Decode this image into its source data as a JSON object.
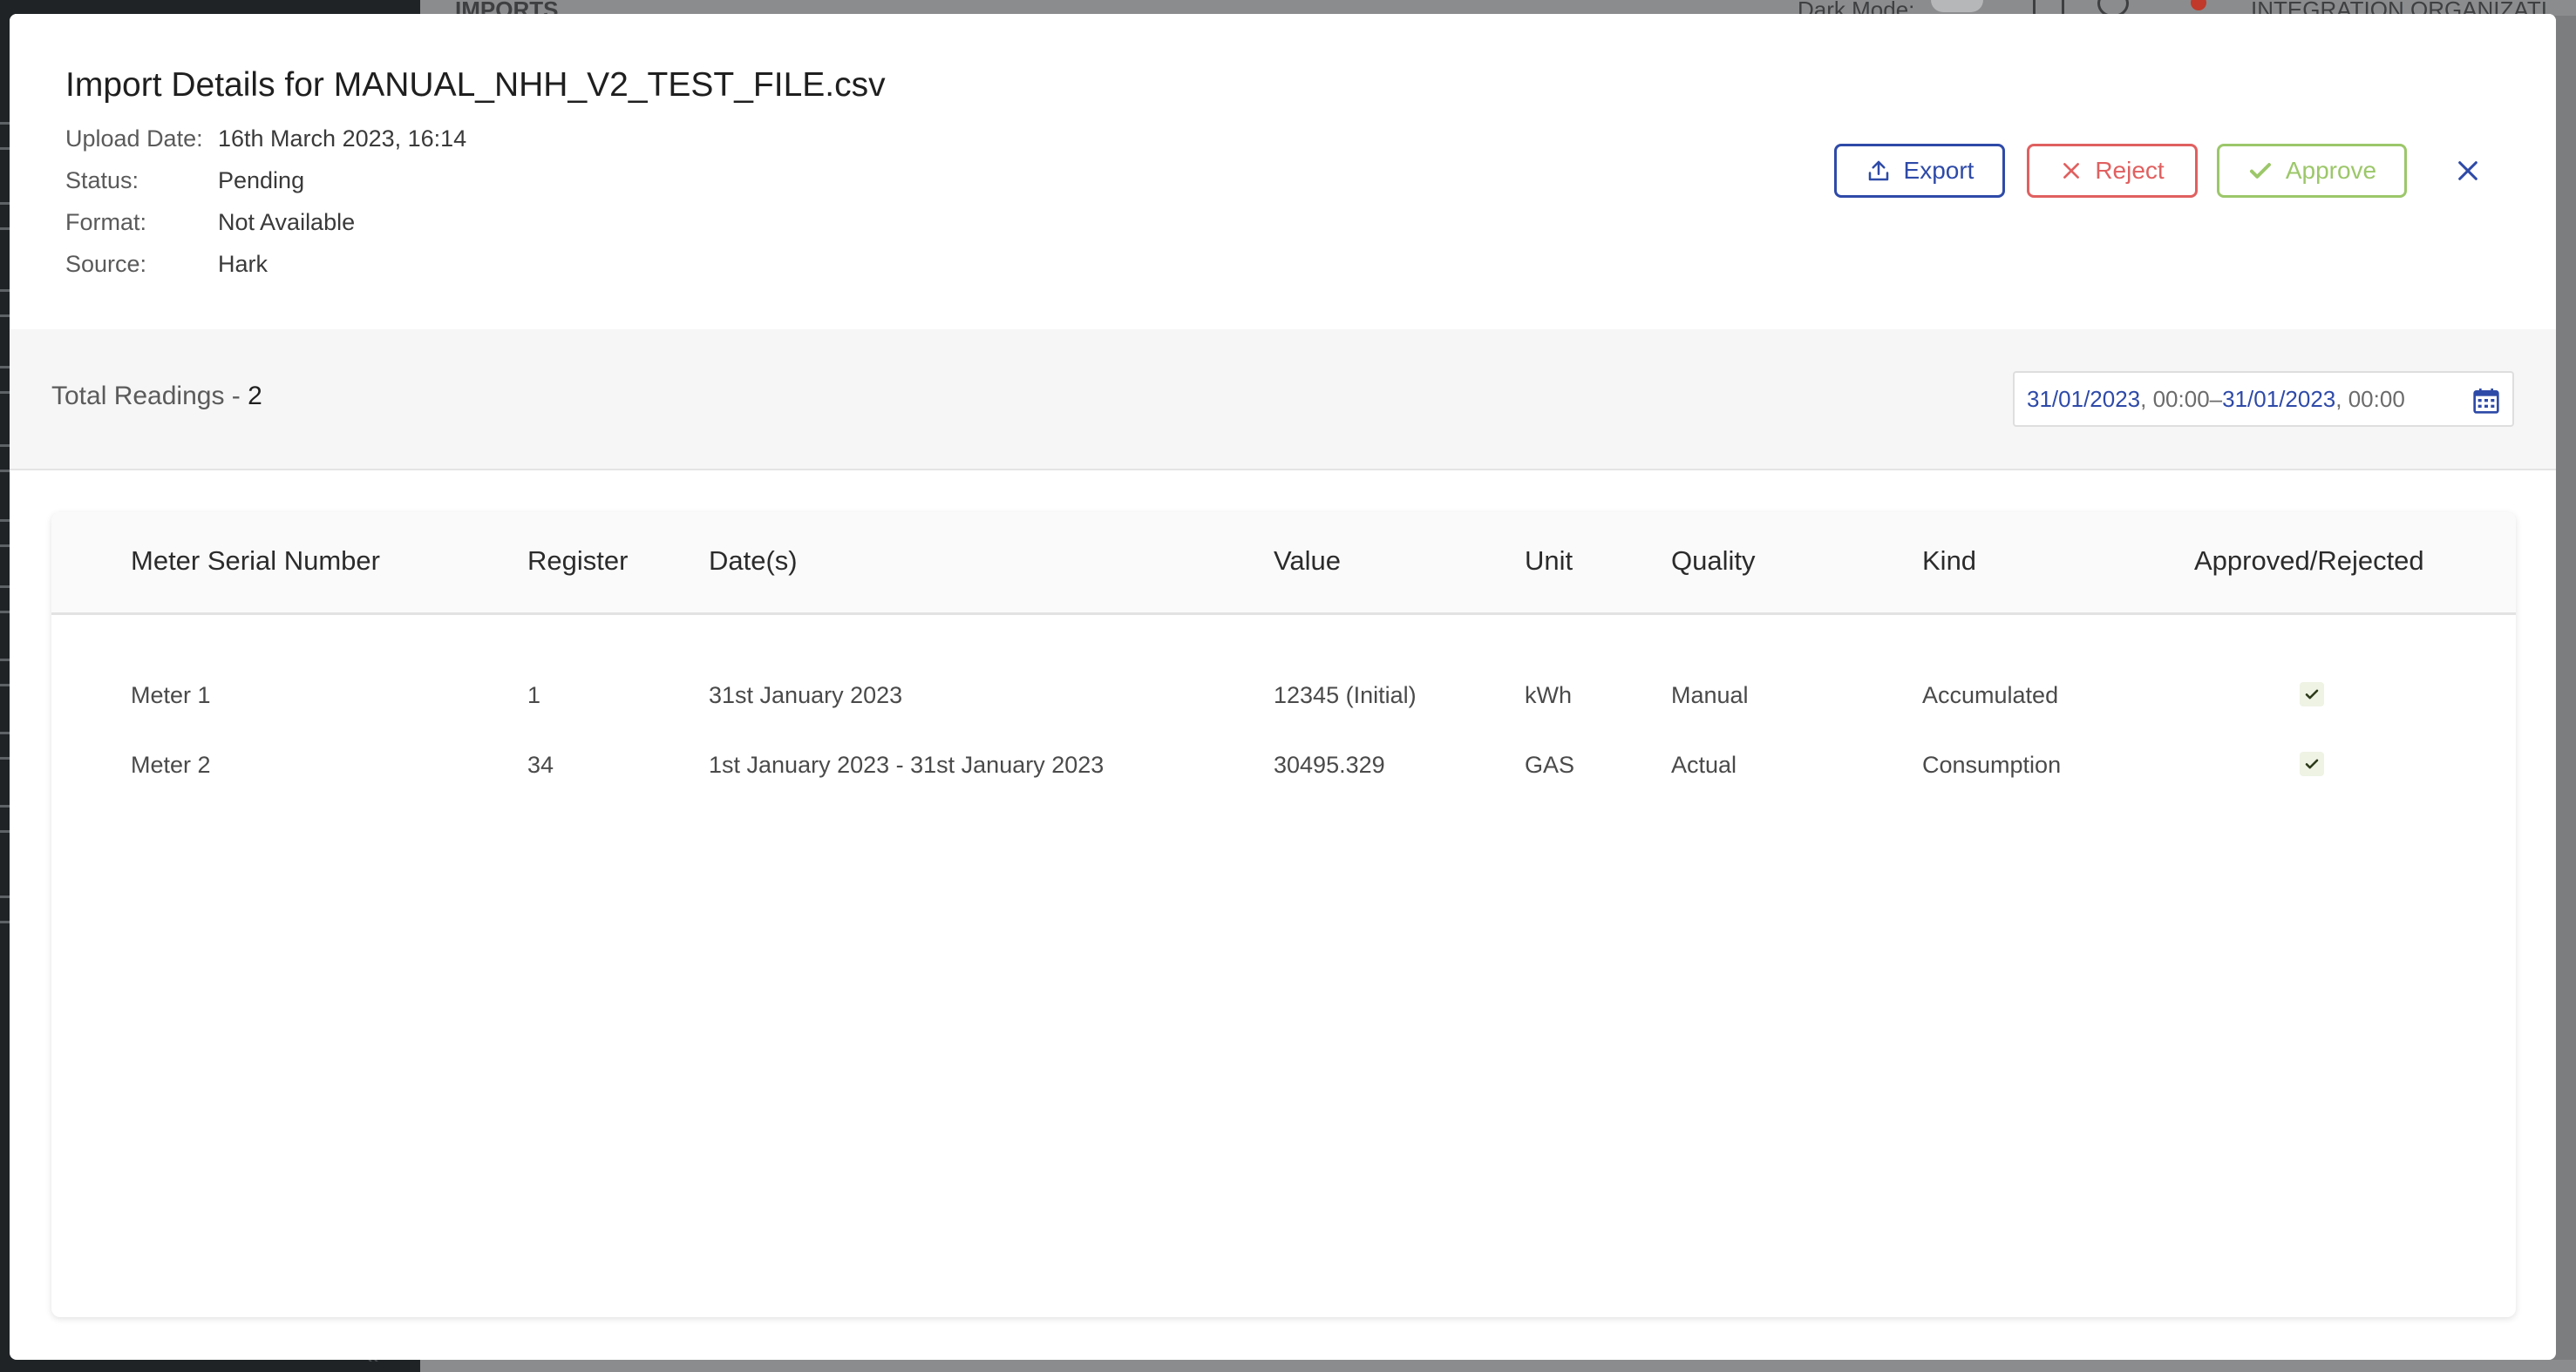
{
  "background": {
    "header_title": "IMPORTS",
    "dark_mode_label": "Dark Mode:",
    "org_name": "INTEGRATION ORGANIZATI"
  },
  "modal": {
    "title": "Import Details for MANUAL_NHH_V2_TEST_FILE.csv",
    "meta": [
      {
        "key": "Upload Date:",
        "value": "16th March 2023, 16:14"
      },
      {
        "key": "Status:",
        "value": "Pending"
      },
      {
        "key": "Format:",
        "value": "Not Available"
      },
      {
        "key": "Source:",
        "value": "Hark"
      }
    ],
    "actions": {
      "export": "Export",
      "reject": "Reject",
      "approve": "Approve"
    },
    "icons": {
      "export": "upload-icon",
      "reject": "x-icon",
      "approve": "check-icon",
      "close": "close-icon",
      "calendar": "calendar-icon"
    }
  },
  "summary": {
    "total_label": "Total Readings - ",
    "total_value": "2"
  },
  "date_range": {
    "start_date": "31/01/2023",
    "start_time": ", 00:00",
    "separator": " – ",
    "end_date": "31/01/2023",
    "end_time": ", 00:00"
  },
  "table": {
    "columns": [
      "Meter Serial Number",
      "Register",
      "Date(s)",
      "Value",
      "Unit",
      "Quality",
      "Kind",
      "Approved/Rejected"
    ],
    "rows": [
      {
        "meter": "Meter 1",
        "register": "1",
        "dates": "31st January 2023",
        "value": "12345 (Initial)",
        "unit": "kWh",
        "quality": "Manual",
        "kind": "Accumulated",
        "approved": true
      },
      {
        "meter": "Meter 2",
        "register": "34",
        "dates": "1st January 2023 - 31st January 2023",
        "value": "30495.329",
        "unit": "GAS",
        "quality": "Actual",
        "kind": "Consumption",
        "approved": true
      }
    ]
  },
  "colors": {
    "primary": "#2e4aa8",
    "reject": "#e06060",
    "approve": "#9cc76a"
  }
}
